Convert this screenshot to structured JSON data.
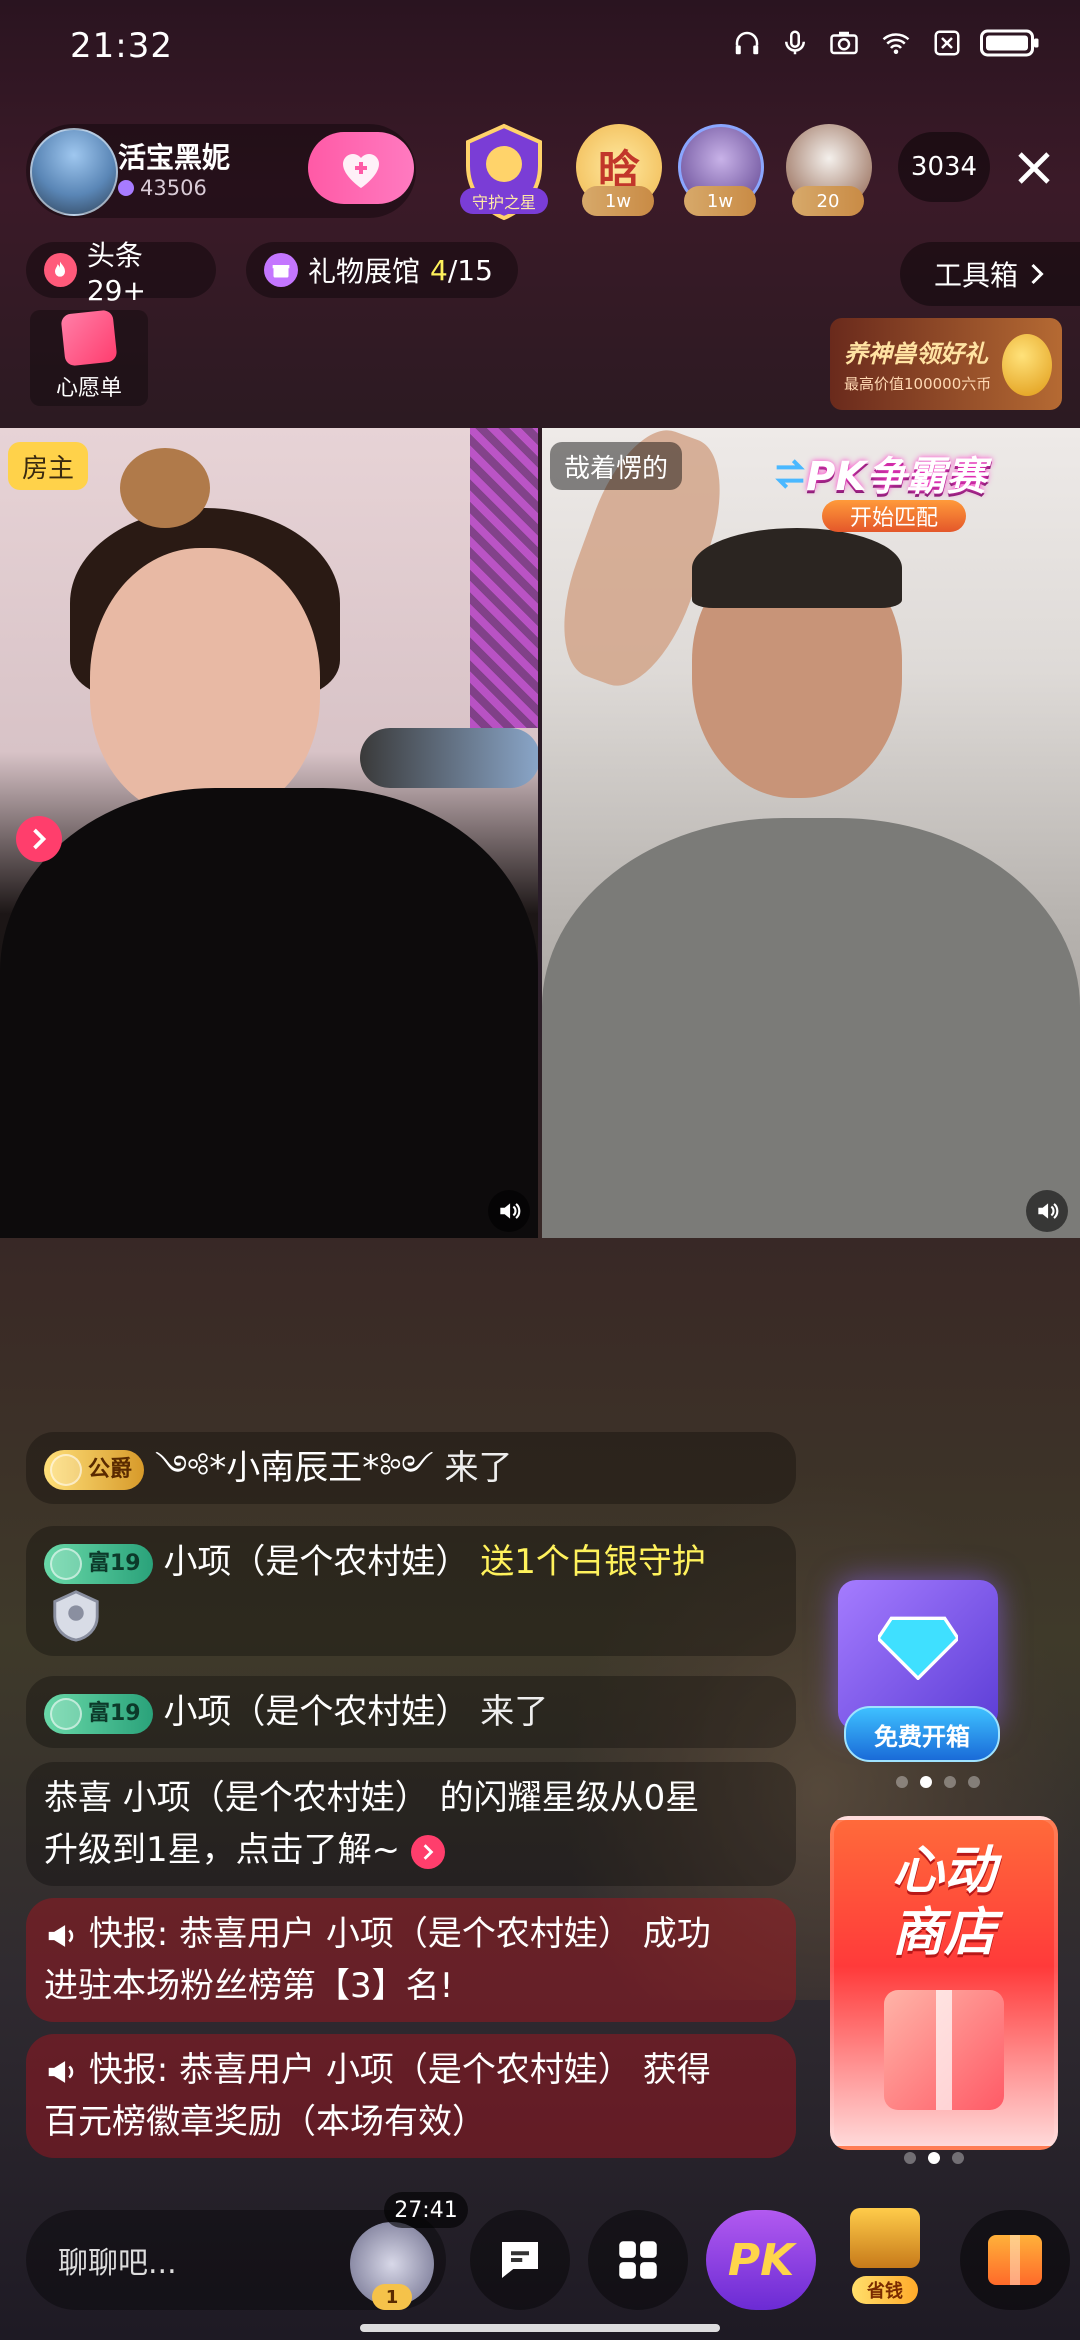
{
  "status_bar": {
    "time": "21:32"
  },
  "host": {
    "name": "活宝黑妮",
    "fans": "43506"
  },
  "viewers": [
    {
      "badge": ""
    },
    {
      "badge": "1w"
    },
    {
      "badge": "1w"
    },
    {
      "badge": "20"
    }
  ],
  "guardian_label": "守护之星",
  "viewer_count": "3034",
  "row2": {
    "headline": "头条29+",
    "gift_hall": "礼物展馆",
    "gift_hall_progress": "4",
    "gift_hall_total": "/15",
    "toolbox": "工具箱"
  },
  "wishlist": "心愿单",
  "promo": {
    "title": "养神兽领好礼",
    "sub": "最高价值100000六币"
  },
  "video": {
    "host_tag": "房主",
    "peer_tag": "哉着愣的",
    "pk_title": "PK争霸赛",
    "pk_sub": "开始匹配"
  },
  "chat": [
    {
      "badge": "公爵",
      "user": "*小南辰王*",
      "text": "来了"
    },
    {
      "badge": "富19",
      "user": "小项（是个农村娃）",
      "text": "送1个白银守护"
    },
    {
      "badge": "富19",
      "user": "小项（是个农村娃）",
      "text": "来了"
    },
    {
      "text1": "恭喜 小项（是个农村娃） 的闪耀星级从0星",
      "text2": "升级到1星，点击了解~"
    },
    {
      "line1": "快报: 恭喜用户 小项（是个农村娃） 成功",
      "line2": "进驻本场粉丝榜第【3】名!"
    },
    {
      "line1": "快报: 恭喜用户 小项（是个农村娃） 获得",
      "line2": "百元榜徽章奖励（本场有效）"
    }
  ],
  "treasure_btn": "免费开箱",
  "shop": {
    "line1": "心动",
    "line2": "商店"
  },
  "bottom": {
    "input_placeholder": "聊聊吧...",
    "timer": "27:41",
    "rank": "1",
    "pk": "PK",
    "save": "省钱"
  }
}
